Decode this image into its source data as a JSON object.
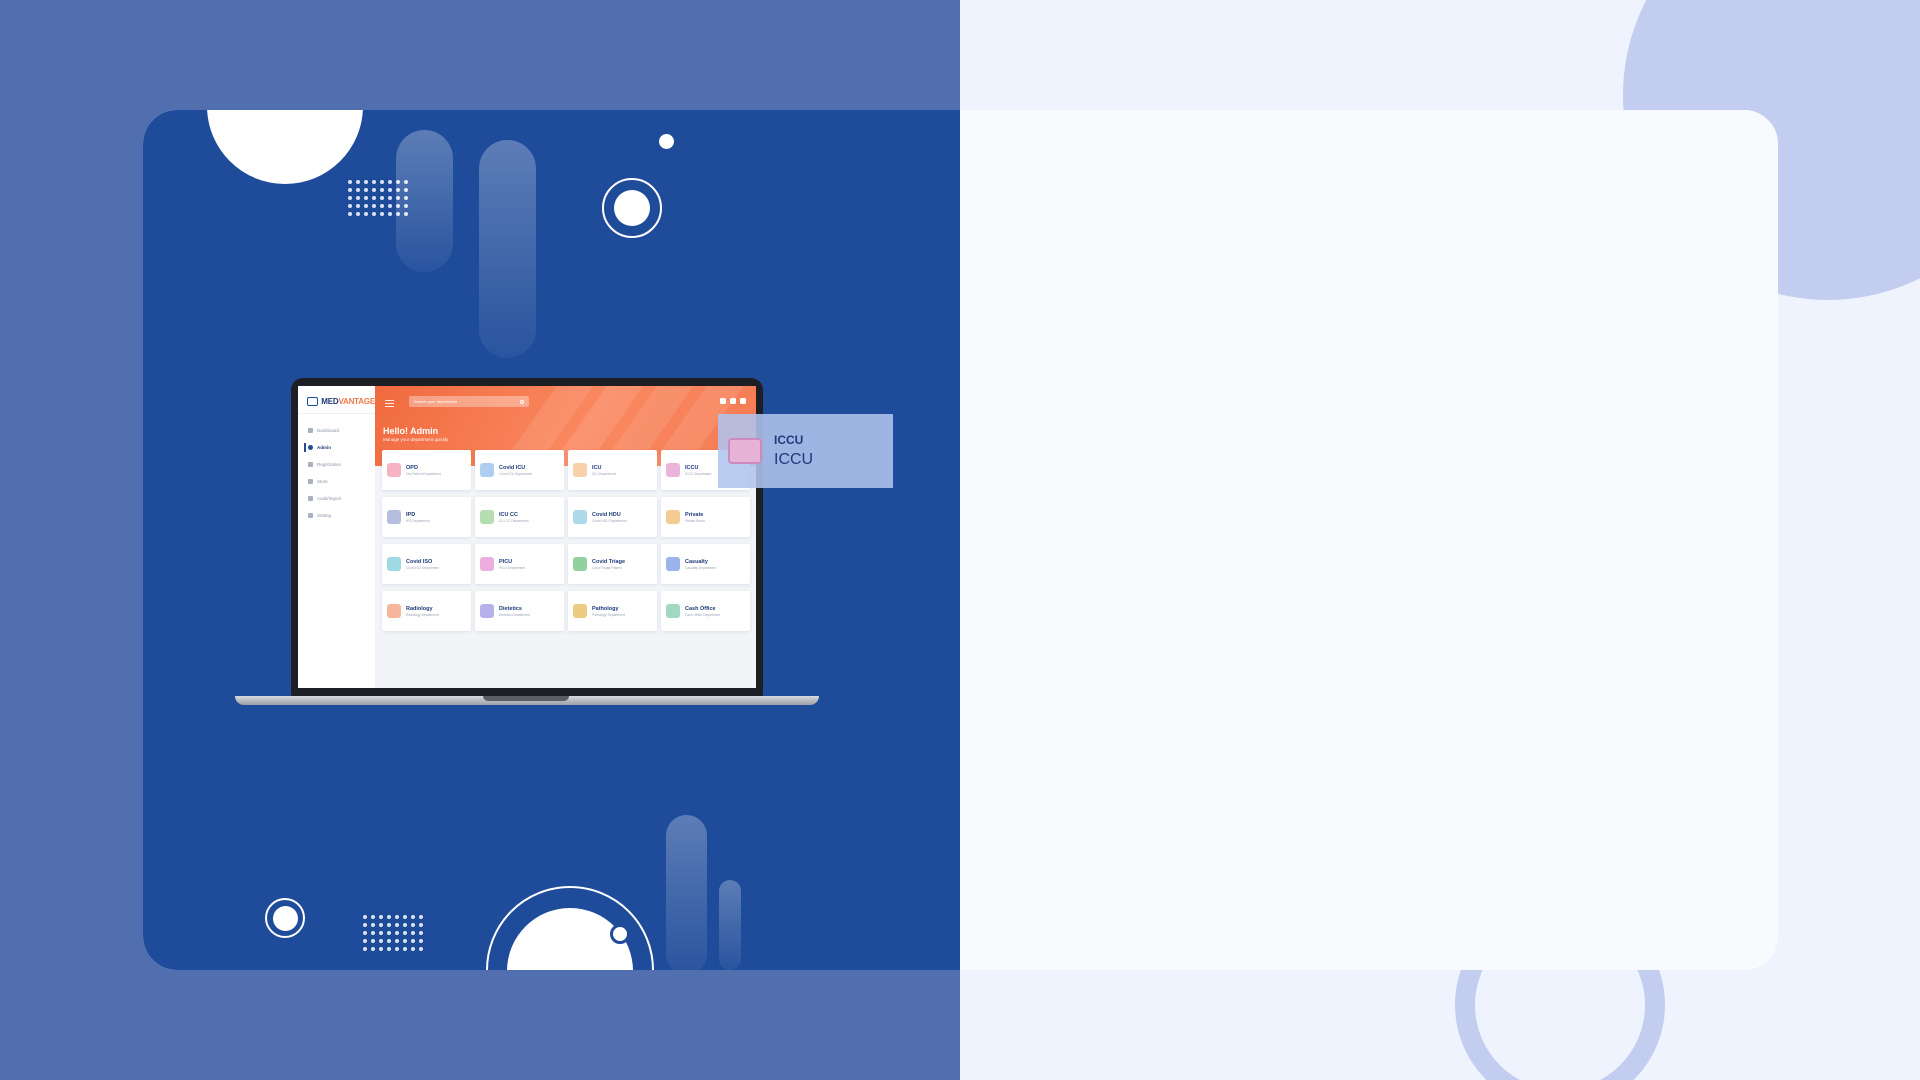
{
  "app": {
    "logo": {
      "brand_left": "MED",
      "brand_right": "VANTAGE"
    },
    "search": {
      "placeholder": "Search your department"
    },
    "sidebar": {
      "items": [
        {
          "label": "Dashboard",
          "active": false
        },
        {
          "label": "Admin",
          "active": true
        },
        {
          "label": "Registration",
          "active": false
        },
        {
          "label": "Store",
          "active": false
        },
        {
          "label": "Audit/Import",
          "active": false
        },
        {
          "label": "Setting",
          "active": false
        }
      ]
    },
    "hero": {
      "greeting": "Hello! Admin",
      "subtitle": "Manage your department quickly"
    },
    "departments": [
      {
        "name": "OPD",
        "sub": "Out Patient Department",
        "icon": "opd-icon",
        "color": "#f4a6b8"
      },
      {
        "name": "Covid ICU",
        "sub": "Covid ICU Department",
        "icon": "covid-icu-icon",
        "color": "#9fc6ef"
      },
      {
        "name": "ICU",
        "sub": "ICU Department",
        "icon": "icu-icon",
        "color": "#f5c99a"
      },
      {
        "name": "ICCU",
        "sub": "ICCU Department",
        "icon": "iccu-icon",
        "color": "#e6a8d5"
      },
      {
        "name": "IPD",
        "sub": "IPD Department",
        "icon": "ipd-icon",
        "color": "#a8b3d8"
      },
      {
        "name": "ICU CC",
        "sub": "ICU CC Department",
        "icon": "icu-cc-icon",
        "color": "#a9d7a4"
      },
      {
        "name": "Covid HDU",
        "sub": "Covid HDU Department",
        "icon": "covid-hdu-icon",
        "color": "#9fd3e8"
      },
      {
        "name": "Private",
        "sub": "Private Room",
        "icon": "private-icon",
        "color": "#f2c27c"
      },
      {
        "name": "Covid ISO",
        "sub": "Covid ISO Department",
        "icon": "covid-iso-icon",
        "color": "#8ed2df"
      },
      {
        "name": "PICU",
        "sub": "PICU Department",
        "icon": "picu-icon",
        "color": "#e8a0d8"
      },
      {
        "name": "Covid Triage",
        "sub": "Covid Triage Patient",
        "icon": "covid-triage-icon",
        "color": "#7fc98b"
      },
      {
        "name": "Casualty",
        "sub": "Casualty Department",
        "icon": "casualty-icon",
        "color": "#8aa6e8"
      },
      {
        "name": "Radiology",
        "sub": "Radiology Department",
        "icon": "radiology-icon",
        "color": "#f3a98a"
      },
      {
        "name": "Dietetics",
        "sub": "Dietetics Department",
        "icon": "dietetics-icon",
        "color": "#a9a3e6"
      },
      {
        "name": "Pathology",
        "sub": "Pathology Department",
        "icon": "pathology-icon",
        "color": "#e7c36c"
      },
      {
        "name": "Cash Office",
        "sub": "Cash Office Department",
        "icon": "cash-office-icon",
        "color": "#8fd1b5"
      }
    ]
  },
  "tooltip": {
    "title": "ICCU",
    "label": "ICCU",
    "icon": "iccu-icon",
    "color": "#e6b3d7"
  },
  "colors": {
    "page_left_bg": "#516fae",
    "page_right_bg": "#eef3fd",
    "card_left_bg": "#1e4b9a",
    "card_right_bg": "#f8fafd",
    "accent_orange": "#f06a3e",
    "accent_circle": "#c2cdf0"
  }
}
